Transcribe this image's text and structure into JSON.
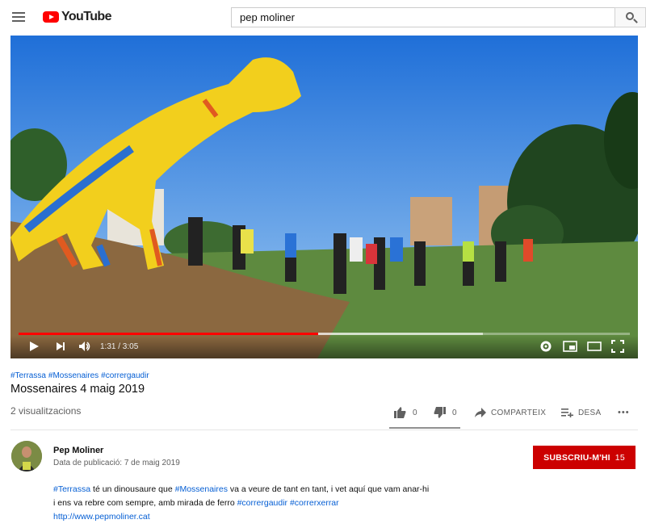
{
  "header": {
    "logo_text": "YouTube",
    "search": {
      "value": "pep moliner"
    }
  },
  "player": {
    "time": "1:31 / 3:05",
    "played_fraction": 0.49,
    "buffered_fraction": 0.76
  },
  "video": {
    "hashtags": [
      "#Terrassa",
      "#Mossenaires",
      "#corrergaudir"
    ],
    "title": "Mossenaires 4 maig 2019",
    "views": "2 visualitzacions",
    "likes": "0",
    "dislikes": "0",
    "share_label": "COMPARTEIX",
    "save_label": "DESA",
    "more_label": "•••"
  },
  "channel": {
    "name": "Pep Moliner",
    "published": "Data de publicació: 7 de maig 2019",
    "subscribe_label": "SUBSCRIU-M'HI",
    "subscriber_count": "15"
  },
  "description": {
    "tag1": "#Terrassa",
    "t1": " té un dinousaure que ",
    "tag2": "#Mossenaires",
    "t2": " va a veure de tant en tant, i vet aquí que vam anar-hi",
    "t3": "i ens va rebre com sempre, amb mirada de ferro ",
    "tag3": "#corrergaudir",
    "t4": " ",
    "tag4": "#correrxerrar",
    "link": "http://www.pepmoliner.cat"
  },
  "colors": {
    "brand_red": "#ff0000",
    "subscribe_red": "#cc0000",
    "link_blue": "#065fd4"
  }
}
